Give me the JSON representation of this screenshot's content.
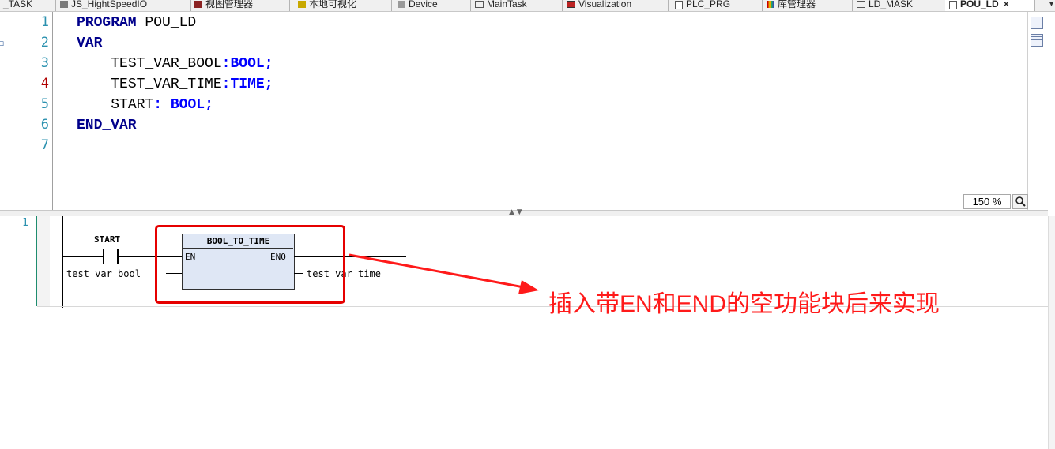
{
  "tabs": [
    {
      "label": "_TASK",
      "icon": "task-icon",
      "active": false
    },
    {
      "label": "JS_HightSpeedIO",
      "icon": "io-icon",
      "active": false
    },
    {
      "label": "视图管理器",
      "icon": "view-manager-icon",
      "active": false
    },
    {
      "label": "本地可视化",
      "icon": "local-visu-icon",
      "active": false
    },
    {
      "label": "Device",
      "icon": "device-icon",
      "active": false
    },
    {
      "label": "MainTask",
      "icon": "task-icon",
      "active": false
    },
    {
      "label": "Visualization",
      "icon": "visualization-icon",
      "active": false
    },
    {
      "label": "PLC_PRG",
      "icon": "pou-icon",
      "active": false
    },
    {
      "label": "库管理器",
      "icon": "library-icon",
      "active": false
    },
    {
      "label": "LD_MASK",
      "icon": "task-icon",
      "active": false
    },
    {
      "label": "POU_LD",
      "icon": "pou-icon",
      "active": true,
      "close": "×"
    }
  ],
  "tab_menu_glyph": "▾",
  "declaration": {
    "line_numbers": [
      "1",
      "2",
      "3",
      "4",
      "5",
      "6",
      "7"
    ],
    "lines": [
      {
        "kw": "PROGRAM",
        "text": " POU_LD"
      },
      {
        "kw": "VAR"
      },
      {
        "indent": "    ",
        "name": "TEST_VAR_BOOL",
        "sep": ":",
        "type": "BOOL",
        "end": ";"
      },
      {
        "indent": "    ",
        "name": "TEST_VAR_TIME",
        "sep": ":",
        "type": "TIME",
        "end": ";"
      },
      {
        "indent": "    ",
        "name": "START",
        "sep": ": ",
        "type": "BOOL",
        "end": ";"
      },
      {
        "kw": "END_VAR"
      }
    ]
  },
  "zoom": {
    "value": "150 %"
  },
  "ld": {
    "network_number": "1",
    "contact_var": "START",
    "input_var": "test_var_bool",
    "output_var": "test_var_time",
    "block": {
      "name": "BOOL_TO_TIME",
      "en": "EN",
      "eno": "ENO"
    }
  },
  "annotation": {
    "text": "插入带EN和END的空功能块后来实现",
    "color": "#ff1a1a"
  }
}
